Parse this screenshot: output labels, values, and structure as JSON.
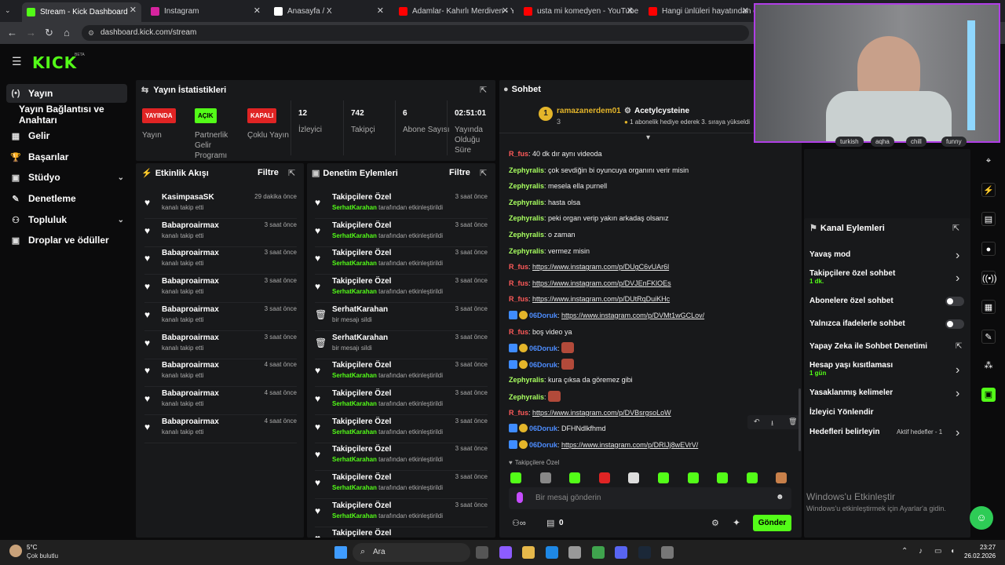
{
  "browser": {
    "tabs": [
      {
        "title": "Stream - Kick Dashboard",
        "icon": "kick-icon",
        "color": "#53fc18"
      },
      {
        "title": "Instagram",
        "icon": "instagram-icon",
        "color": "#d6249f"
      },
      {
        "title": "Anasayfa / X",
        "icon": "x-icon",
        "color": "#ffffff"
      },
      {
        "title": "Adamlar- Kahırlı Merdiven - Yo",
        "icon": "youtube-icon",
        "color": "#ff0000"
      },
      {
        "title": "usta mi komedyen - YouTube",
        "icon": "youtube-icon",
        "color": "#ff0000"
      },
      {
        "title": "Hangi ünlüleri hayatından çıkar",
        "icon": "youtube-icon",
        "color": "#ff0000"
      }
    ],
    "url": "dashboard.kick.com/stream"
  },
  "brand": {
    "logo": "KICK",
    "beta": "BETA",
    "accent": "#53fc18"
  },
  "sidebar": {
    "items": [
      {
        "label": "Yayın",
        "icon": "broadcast-icon"
      },
      {
        "label": "Yayın Bağlantısı ve Anahtarı",
        "icon": ""
      },
      {
        "label": "Gelir",
        "icon": "money-icon"
      },
      {
        "label": "Başarılar",
        "icon": "trophy-icon"
      },
      {
        "label": "Stüdyo",
        "icon": "studio-icon"
      },
      {
        "label": "Denetleme",
        "icon": "wrench-icon"
      },
      {
        "label": "Topluluk",
        "icon": "community-icon"
      },
      {
        "label": "Droplar ve ödüller",
        "icon": "drops-icon"
      }
    ]
  },
  "stats": {
    "title": "Yayın İstatistikleri",
    "items": [
      {
        "badge": "YAYINDA",
        "label": "Yayın"
      },
      {
        "badge": "AÇIK",
        "label": "Partnerlik Gelir Programı"
      },
      {
        "badge": "KAPALI",
        "label": "Çoklu Yayın"
      },
      {
        "value": "12",
        "label": "İzleyici"
      },
      {
        "value": "742",
        "label": "Takipçi"
      },
      {
        "value": "6",
        "label": "Abone Sayısı"
      },
      {
        "value": "02:51:01",
        "label": "Yayında Olduğu Süre"
      }
    ]
  },
  "activity": {
    "title": "Etkinlik Akışı",
    "filter": "Filtre",
    "rows": [
      {
        "name": "KasimpasaSK",
        "sub": "kanalı takip etti",
        "time": "29 dakika önce"
      },
      {
        "name": "Babaproairmax",
        "sub": "kanalı takip etti",
        "time": "3 saat önce"
      },
      {
        "name": "Babaproairmax",
        "sub": "kanalı takip etti",
        "time": "3 saat önce"
      },
      {
        "name": "Babaproairmax",
        "sub": "kanalı takip etti",
        "time": "3 saat önce"
      },
      {
        "name": "Babaproairmax",
        "sub": "kanalı takip etti",
        "time": "3 saat önce"
      },
      {
        "name": "Babaproairmax",
        "sub": "kanalı takip etti",
        "time": "3 saat önce"
      },
      {
        "name": "Babaproairmax",
        "sub": "kanalı takip etti",
        "time": "4 saat önce"
      },
      {
        "name": "Babaproairmax",
        "sub": "kanalı takip etti",
        "time": "4 saat önce"
      },
      {
        "name": "Babaproairmax",
        "sub": "kanalı takip etti",
        "time": "4 saat önce"
      }
    ]
  },
  "moderation": {
    "title": "Denetim Eylemleri",
    "filter": "Filtre",
    "rows": [
      {
        "name": "Takipçilere Özel",
        "user": "SerhatKarahan",
        "sub": "tarafından etkinleştirildi",
        "time": "3 saat önce",
        "icon": "heart-icon"
      },
      {
        "name": "Takipçilere Özel",
        "user": "SerhatKarahan",
        "sub": "tarafından etkinleştirildi",
        "time": "3 saat önce",
        "icon": "heart-icon"
      },
      {
        "name": "Takipçilere Özel",
        "user": "SerhatKarahan",
        "sub": "tarafından etkinleştirildi",
        "time": "3 saat önce",
        "icon": "heart-icon"
      },
      {
        "name": "Takipçilere Özel",
        "user": "SerhatKarahan",
        "sub": "tarafından etkinleştirildi",
        "time": "3 saat önce",
        "icon": "heart-icon"
      },
      {
        "name": "SerhatKarahan",
        "user": "",
        "sub": "bir mesajı sildi",
        "time": "3 saat önce",
        "icon": "trash-icon"
      },
      {
        "name": "SerhatKarahan",
        "user": "",
        "sub": "bir mesajı sildi",
        "time": "3 saat önce",
        "icon": "trash-icon"
      },
      {
        "name": "Takipçilere Özel",
        "user": "SerhatKarahan",
        "sub": "tarafından etkinleştirildi",
        "time": "3 saat önce",
        "icon": "heart-icon"
      },
      {
        "name": "Takipçilere Özel",
        "user": "SerhatKarahan",
        "sub": "tarafından etkinleştirildi",
        "time": "3 saat önce",
        "icon": "heart-icon"
      },
      {
        "name": "Takipçilere Özel",
        "user": "SerhatKarahan",
        "sub": "tarafından etkinleştirildi",
        "time": "3 saat önce",
        "icon": "heart-icon"
      },
      {
        "name": "Takipçilere Özel",
        "user": "SerhatKarahan",
        "sub": "tarafından etkinleştirildi",
        "time": "3 saat önce",
        "icon": "heart-icon"
      },
      {
        "name": "Takipçilere Özel",
        "user": "SerhatKarahan",
        "sub": "tarafından etkinleştirildi",
        "time": "3 saat önce",
        "icon": "heart-icon"
      },
      {
        "name": "Takipçilere Özel",
        "user": "SerhatKarahan",
        "sub": "tarafından etkinleştirildi",
        "time": "3 saat önce",
        "icon": "heart-icon"
      },
      {
        "name": "Takipçilere Özel",
        "user": "",
        "sub": "",
        "time": "",
        "icon": "heart-icon"
      }
    ]
  },
  "chat": {
    "title": "Sohbet",
    "pinned": {
      "user": "ramazanerdem01",
      "count": "3",
      "gift_user": "Acetylcysteine",
      "gift_text": "1 abonelik hediye ederek 3. sıraya yükseldi"
    },
    "messages": [
      {
        "user": "R_fus",
        "color": "#ff5a5a",
        "text": "40 dk dır aynı videoda",
        "link": false,
        "badges": false
      },
      {
        "user": "Zephyralis",
        "color": "#a8ff60",
        "text": "çok sevdiğin bi oyuncuya organını verir misin",
        "link": false,
        "badges": false
      },
      {
        "user": "Zephyralis",
        "color": "#a8ff60",
        "text": "mesela ella purnell",
        "link": false,
        "badges": false
      },
      {
        "user": "Zephyralis",
        "color": "#a8ff60",
        "text": "hasta olsa",
        "link": false,
        "badges": false
      },
      {
        "user": "Zephyralis",
        "color": "#a8ff60",
        "text": "peki organ verip yakın arkadaş olsanız",
        "link": false,
        "badges": false
      },
      {
        "user": "Zephyralis",
        "color": "#a8ff60",
        "text": "o zaman",
        "link": false,
        "badges": false
      },
      {
        "user": "Zephyralis",
        "color": "#a8ff60",
        "text": "vermez misin",
        "link": false,
        "badges": false
      },
      {
        "user": "R_fus",
        "color": "#ff5a5a",
        "text": "https://www.instagram.com/p/DUgC6vUAr6l",
        "link": true,
        "badges": false
      },
      {
        "user": "R_fus",
        "color": "#ff5a5a",
        "text": "https://www.instagram.com/p/DVJEnFKlOEs",
        "link": true,
        "badges": false
      },
      {
        "user": "R_fus",
        "color": "#ff5a5a",
        "text": "https://www.instagram.com/p/DUtRqDuiKHc",
        "link": true,
        "badges": false
      },
      {
        "user": "06Doruk",
        "color": "#4d8dff",
        "text": "https://www.instagram.com/p/DVMt1wGCLov/",
        "link": true,
        "badges": true
      },
      {
        "user": "R_fus",
        "color": "#ff5a5a",
        "text": "boş video ya",
        "link": false,
        "badges": false
      },
      {
        "user": "06Doruk",
        "color": "#4d8dff",
        "text": "",
        "link": false,
        "badges": true,
        "emote": true
      },
      {
        "user": "06Doruk",
        "color": "#4d8dff",
        "text": "",
        "link": false,
        "badges": true,
        "emote": true
      },
      {
        "user": "Zephyralis",
        "color": "#a8ff60",
        "text": "kura çıksa da göremez gibi",
        "link": false,
        "badges": false
      },
      {
        "user": "Zephyralis",
        "color": "#a8ff60",
        "text": "",
        "link": false,
        "badges": false,
        "emote": true
      },
      {
        "user": "R_fus",
        "color": "#ff5a5a",
        "text": "https://www.instagram.com/p/DVBsrgsoLoW",
        "link": true,
        "badges": false
      },
      {
        "user": "06Doruk",
        "color": "#4d8dff",
        "text": "DFHNdlkfhmd",
        "link": false,
        "badges": true
      },
      {
        "user": "06Doruk",
        "color": "#4d8dff",
        "text": "https://www.instagram.com/p/DRIJj8wEVrV/",
        "link": true,
        "badges": true
      }
    ],
    "followers_only": "Takipçilere Özel",
    "input_placeholder": "Bir mesaj gönderin",
    "points": "0",
    "send": "Gönder"
  },
  "tags": [
    "turkish",
    "aqha",
    "chill",
    "funny"
  ],
  "channel_actions": {
    "title": "Kanal Eylemleri",
    "items": [
      {
        "label": "Yavaş mod",
        "sub": "",
        "control": "arrow"
      },
      {
        "label": "Takipçilere özel sohbet",
        "sub": "1 dk.",
        "control": "arrow"
      },
      {
        "label": "Abonelere özel sohbet",
        "sub": "",
        "control": "toggle"
      },
      {
        "label": "Yalnızca ifadelerle sohbet",
        "sub": "",
        "control": "toggle"
      },
      {
        "label": "Yapay Zeka ile Sohbet Denetimi",
        "sub": "",
        "control": "external"
      },
      {
        "label": "Hesap yaşı kısıtlaması",
        "sub": "1 gün",
        "control": "arrow"
      },
      {
        "label": "Yasaklanmış kelimeler",
        "sub": "",
        "control": "arrow"
      },
      {
        "label": "İzleyici Yönlendir",
        "sub": "",
        "control": "none"
      },
      {
        "label": "Hedefleri belirleyin",
        "sub": "",
        "control": "arrow",
        "extra": "Aktif hedefler - 1"
      }
    ]
  },
  "watermark": {
    "line1": "Windows'u Etkinleştir",
    "line2": "Windows'u etkinleştirmek için Ayarlar'a gidin."
  },
  "taskbar": {
    "weather_temp": "5°C",
    "weather_desc": "Çok bulutlu",
    "search": "Ara",
    "time": "23:27",
    "date": "26.02.2026"
  }
}
